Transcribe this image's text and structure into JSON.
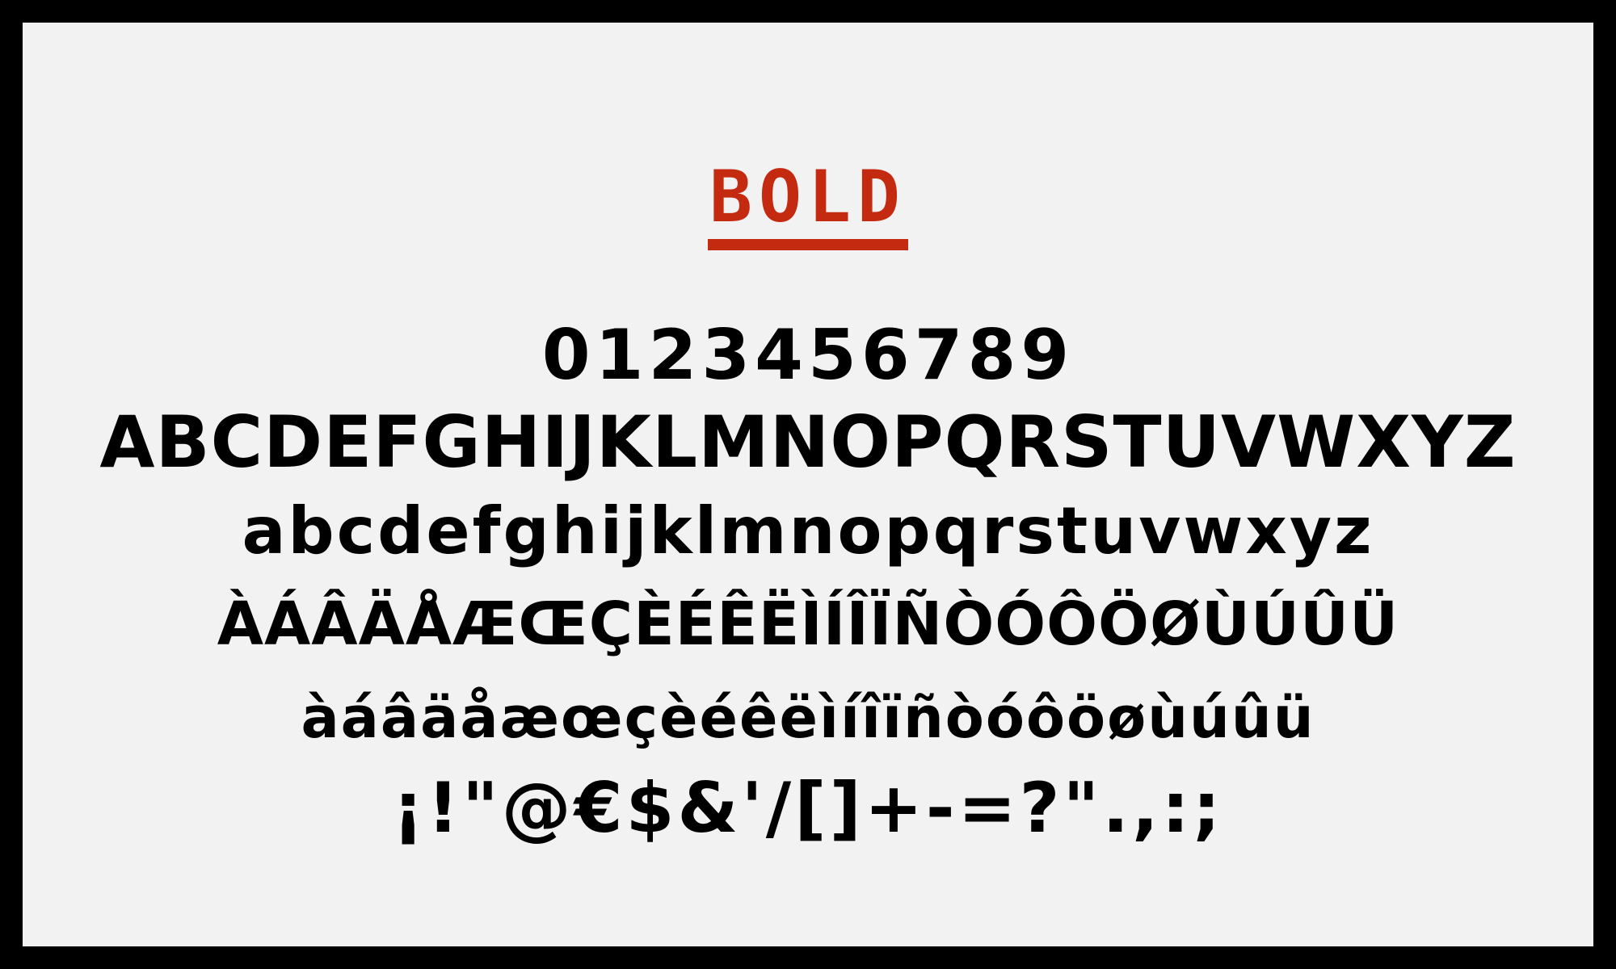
{
  "title": "BOLD",
  "colors": {
    "background": "#f2f2f2",
    "border": "#000000",
    "accent": "#c42a10",
    "glyphs": "#000000"
  },
  "glyph_rows": {
    "digits": "0123456789",
    "uppercase": "ABCDEFGHIJKLMNOPQRSTUVWXYZ",
    "lowercase": "abcdefghijklmnopqrstuvwxyz",
    "uppercase_accented": "ÀÁÂÄÅÆŒÇÈÉÊËÌÍÎÏÑÒÓÔÖØÙÚÛÜ",
    "lowercase_accented": "àáâäåæœçèéêëìíîïñòóôöøùúûü",
    "punctuation": "¡!\"@€$&'/[]+-=?\".,:;"
  }
}
